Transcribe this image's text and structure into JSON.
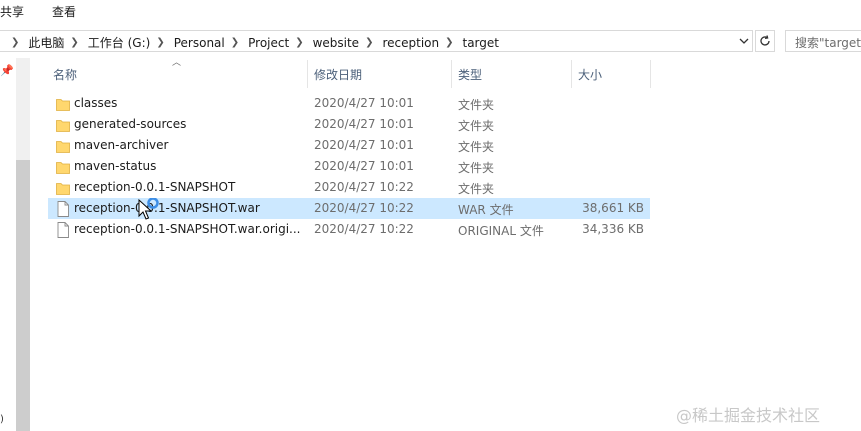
{
  "ribbon": {
    "tabs": [
      "共享",
      "查看"
    ]
  },
  "address": {
    "segments": [
      "此电脑",
      "工作台 (G:)",
      "Personal",
      "Project",
      "website",
      "reception",
      "target"
    ],
    "search_placeholder": "搜索\"target\""
  },
  "columns": {
    "name": "名称",
    "date": "修改日期",
    "type": "类型",
    "size": "大小"
  },
  "files": [
    {
      "name": "classes",
      "date": "2020/4/27 10:01",
      "type": "文件夹",
      "size": "",
      "icon": "folder-icon",
      "selected": false
    },
    {
      "name": "generated-sources",
      "date": "2020/4/27 10:01",
      "type": "文件夹",
      "size": "",
      "icon": "folder-icon",
      "selected": false
    },
    {
      "name": "maven-archiver",
      "date": "2020/4/27 10:01",
      "type": "文件夹",
      "size": "",
      "icon": "folder-icon",
      "selected": false
    },
    {
      "name": "maven-status",
      "date": "2020/4/27 10:01",
      "type": "文件夹",
      "size": "",
      "icon": "folder-icon",
      "selected": false
    },
    {
      "name": "reception-0.0.1-SNAPSHOT",
      "date": "2020/4/27 10:22",
      "type": "文件夹",
      "size": "",
      "icon": "folder-icon",
      "selected": false
    },
    {
      "name": "reception-0.0.1-SNAPSHOT.war",
      "date": "2020/4/27 10:22",
      "type": "WAR 文件",
      "size": "38,661 KB",
      "icon": "file-icon",
      "selected": true
    },
    {
      "name": "reception-0.0.1-SNAPSHOT.war.origi...",
      "date": "2020/4/27 10:22",
      "type": "ORIGINAL 文件",
      "size": "34,336 KB",
      "icon": "file-icon",
      "selected": false
    }
  ],
  "watermark": "@稀土掘金技术社区",
  "colors": {
    "folder": "#ffd76e",
    "selection": "#cce8ff",
    "header_text": "#4c607a"
  }
}
